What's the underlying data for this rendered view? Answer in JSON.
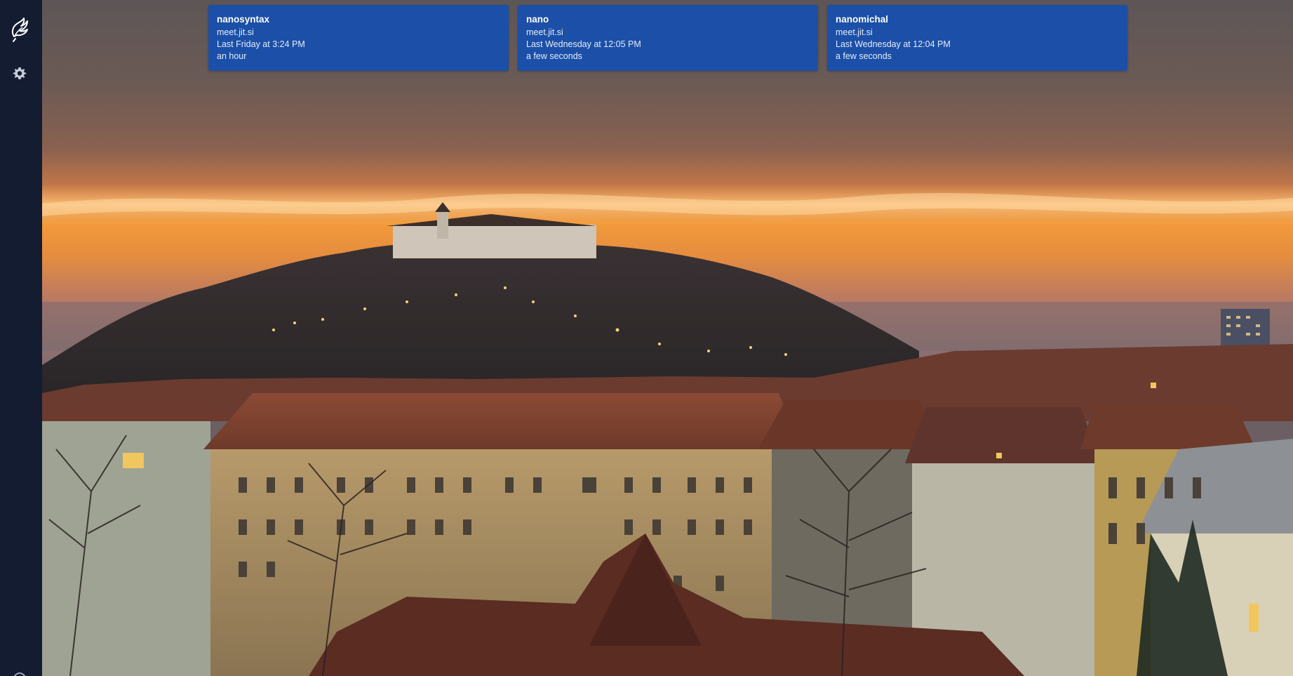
{
  "app": {
    "name": "Jitsi Meet"
  },
  "sidebar": {
    "logo_icon": "jitsi-logo-icon",
    "settings_icon": "gear-icon",
    "help_icon": "help-circle-icon"
  },
  "recent_meetings": [
    {
      "room": "nanosyntax",
      "server": "meet.jit.si",
      "date": "Last Friday at 3:24 PM",
      "duration": "an hour"
    },
    {
      "room": "nano",
      "server": "meet.jit.si",
      "date": "Last Wednesday at 12:05 PM",
      "duration": "a few seconds"
    },
    {
      "room": "nanomichal",
      "server": "meet.jit.si",
      "date": "Last Wednesday at 12:04 PM",
      "duration": "a few seconds"
    }
  ],
  "colors": {
    "sidebar_bg": "#131c30",
    "card_bg": "#1b4fa8",
    "card_text": "#ffffff"
  }
}
